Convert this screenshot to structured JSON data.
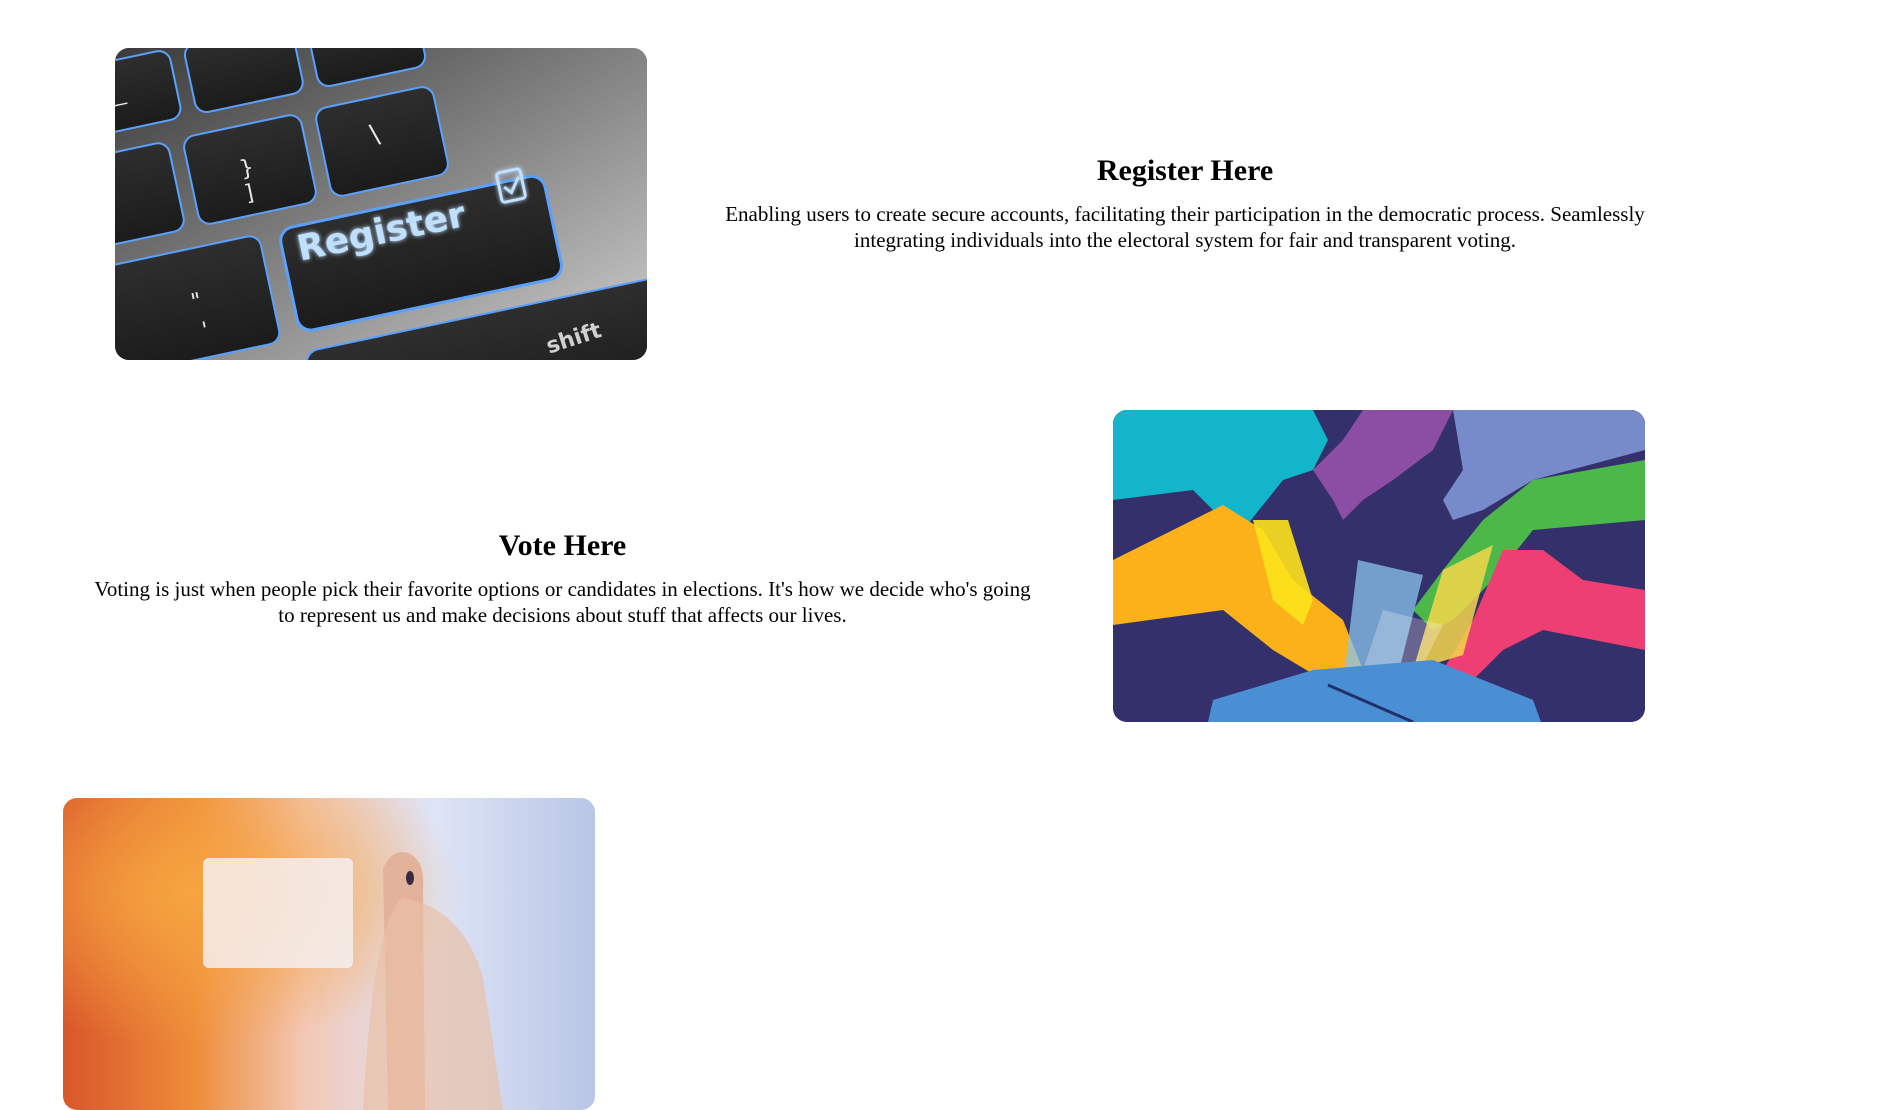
{
  "register": {
    "title": "Register Here",
    "description": "Enabling users to create secure accounts, facilitating their participation in the democratic process. Seamlessly integrating individuals into the electoral system for fair and transparent voting.",
    "image_key_label": "Register",
    "image_shift_label": "shift"
  },
  "vote": {
    "title": "Vote Here",
    "description": "Voting is just when people pick their favorite options or candidates in elections. It's how we decide who's going to represent us and make decisions about stuff that affects our lives."
  },
  "colors": {
    "background": "#ffffff",
    "text": "#000000",
    "vote_bg": "#34306b",
    "ballot_box": "#4a8fd4"
  }
}
